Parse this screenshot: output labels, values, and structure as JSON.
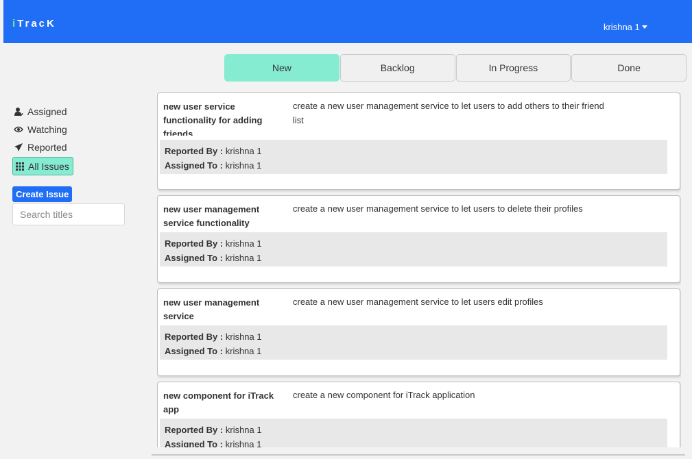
{
  "header": {
    "brand_i": "i",
    "brand_rest": "TracK",
    "user": "krishna 1"
  },
  "tabs": [
    {
      "label": "New"
    },
    {
      "label": "Backlog"
    },
    {
      "label": "In Progress"
    },
    {
      "label": "Done"
    }
  ],
  "sidebar": {
    "items": [
      {
        "label": "Assigned",
        "icon": "user-check-icon"
      },
      {
        "label": "Watching",
        "icon": "eye-icon"
      },
      {
        "label": "Reported",
        "icon": "paper-plane-icon"
      },
      {
        "label": "All Issues",
        "icon": "grid-icon"
      }
    ],
    "create_label": "Create Issue",
    "search_placeholder": "Search titles"
  },
  "labels": {
    "reported_by": "Reported By :",
    "assigned_to": "Assigned To :"
  },
  "issues": [
    {
      "title": "new user service functionality for adding friends",
      "description": "create a new user management service to let users to add others to their friend list",
      "reported_by": "krishna 1",
      "assigned_to": "krishna 1"
    },
    {
      "title": "new user management service functionality",
      "description": "create a new user management service to let users to delete their profiles",
      "reported_by": "krishna 1",
      "assigned_to": "krishna 1"
    },
    {
      "title": "new user management service",
      "description": "create a new user management service to let users edit profiles",
      "reported_by": "krishna 1",
      "assigned_to": "krishna 1"
    },
    {
      "title": "new component for iTrack app",
      "description": "create a new component for iTrack application",
      "reported_by": "krishna 1",
      "assigned_to": "krishna 1"
    }
  ]
}
